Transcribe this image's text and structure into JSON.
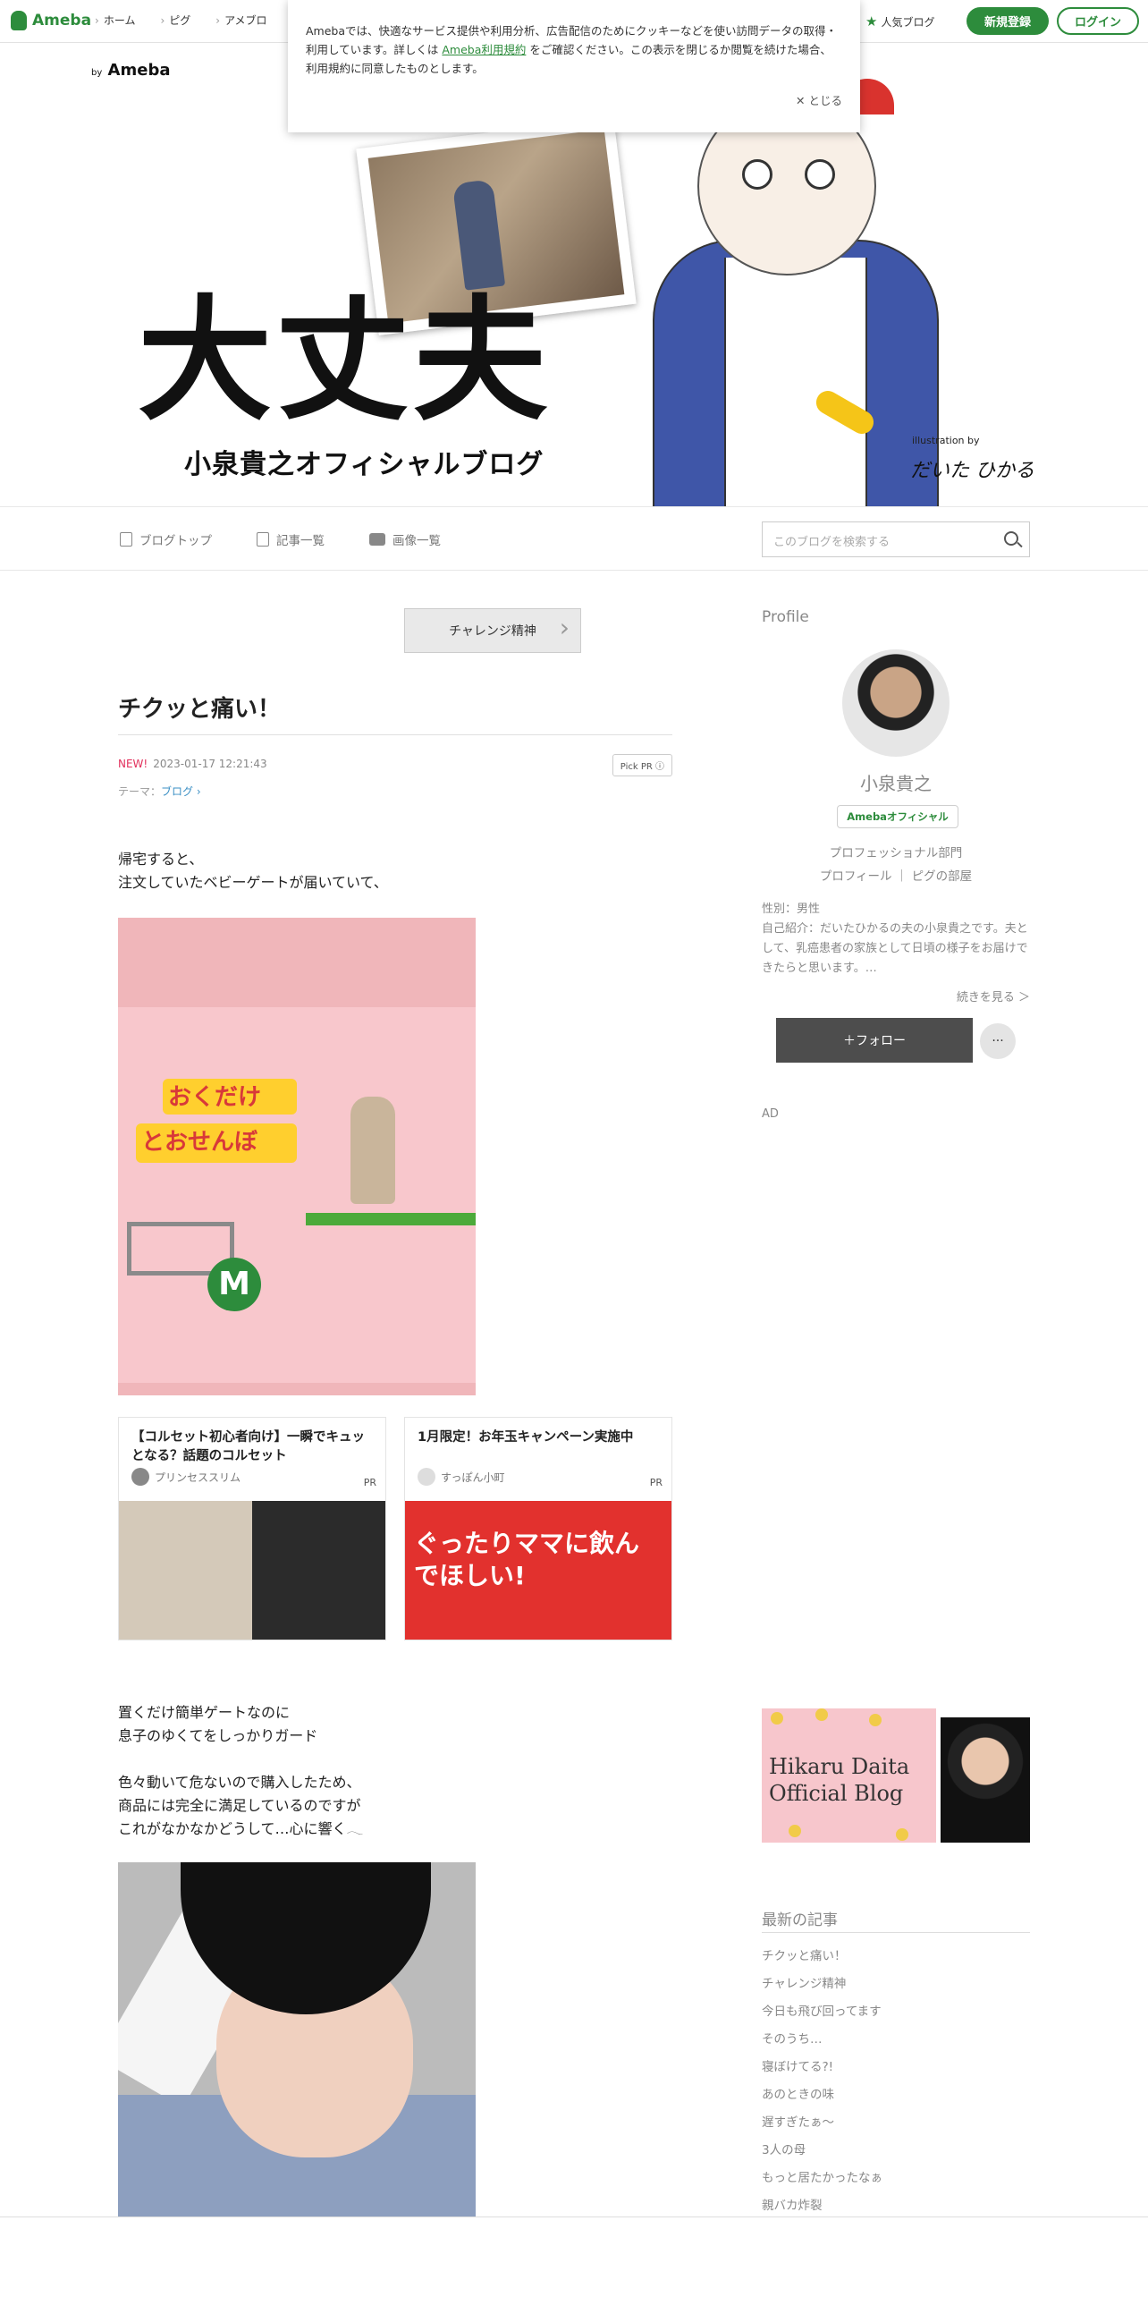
{
  "topbar": {
    "logo": "Ameba",
    "nav": [
      "ホーム",
      "ピグ",
      "アメブロ"
    ],
    "popular": "人気ブログ",
    "register": "新規登録",
    "login": "ログイン"
  },
  "cookie": {
    "text_before": "Amebaでは、快適なサービス提供や利用分析、広告配信のためにクッキーなどを使い訪問データの取得・利用しています。詳しくは",
    "link": "Ameba利用規約",
    "text_after": "をご確認ください。この表示を閉じるか閲覧を続けた場合、利用規約に同意したものとします。",
    "close": "✕ とじる"
  },
  "header": {
    "by": "by",
    "brand": "Ameba",
    "title": "大丈夫",
    "subtitle": "小泉貴之オフィシャルブログ",
    "illustration_by": "illustration by",
    "signature": "だいた ひかる"
  },
  "subnav": {
    "items": [
      "ブログトップ",
      "記事一覧",
      "画像一覧"
    ],
    "search_placeholder": "このブログを検索する"
  },
  "article": {
    "prev_theme": "チャレンジ精神",
    "title": "チクッと痛い！",
    "new": "NEW!",
    "date": "2023-01-17 12:21:43",
    "pickpr": "Pick PR ⓘ",
    "theme_label": "テーマ：",
    "theme": "ブログ ›",
    "para1": [
      "帰宅すると、",
      "注文していたベビーゲートが届いていて、"
    ],
    "para2": [
      "置くだけ簡単ゲートなのに",
      "息子のゆくてをしっかりガード",
      "",
      "色々動いて危ないので購入したため、",
      "商品には完全に満足しているのですが",
      "これがなかなかどうして…心に響く𓂃"
    ]
  },
  "ads": [
    {
      "title": "【コルセット初心者向け】一瞬でキュッとなる？話題のコルセット",
      "source": "プリンセススリム",
      "label": "PR"
    },
    {
      "title": "1月限定！お年玉キャンペーン実施中",
      "source": "すっぽん小町",
      "label": "PR",
      "image_text": "ぐったりママに飲んでほしい!"
    }
  ],
  "sidebar": {
    "profile_heading": "Profile",
    "name": "小泉貴之",
    "official": "Amebaオフィシャル",
    "dept": "プロフェッショナル部門",
    "link1": "プロフィール",
    "link2": "ピグの部屋",
    "gender": "性別：男性",
    "intro": "自己紹介：だいたひかるの夫の小泉貴之です。夫として、乳癌患者の家族として日頃の様子をお届けできたらと思います。…",
    "more": "続きを見る ＞",
    "follow": "＋フォロー",
    "more_btn": "···",
    "ad": "AD",
    "banner_text": [
      "Hikaru Daita",
      "Official Blog"
    ],
    "recent_heading": "最新の記事",
    "recent": [
      "チクッと痛い！",
      "チャレンジ精神",
      "今日も飛び回ってます",
      "そのうち…",
      "寝ぼけてる?!",
      "あのときの味",
      "遅すぎたぁ〜",
      "3人の母",
      "もっと居たかったなぁ",
      "親バカ炸裂"
    ]
  },
  "colors": {
    "brand_green": "#2d8c3c",
    "new_pink": "#e2305c"
  }
}
